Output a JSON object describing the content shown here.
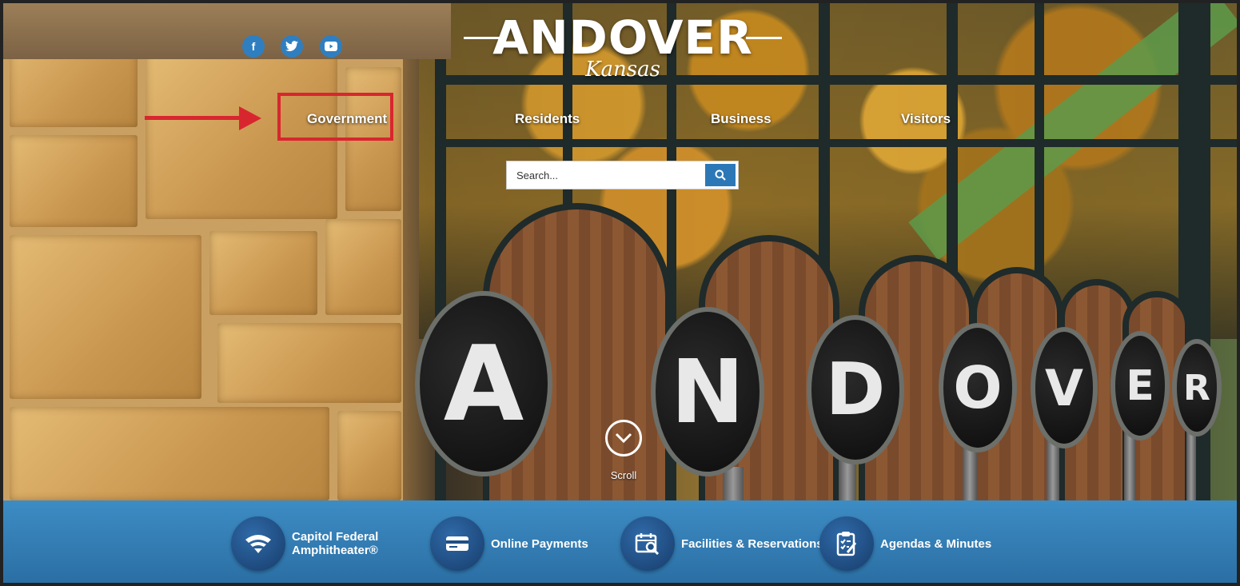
{
  "logo": {
    "title": "ANDOVER",
    "subtitle": "Kansas"
  },
  "social": {
    "facebook": "facebook-icon",
    "twitter": "twitter-icon",
    "youtube": "youtube-icon"
  },
  "nav": {
    "government": "Government",
    "residents": "Residents",
    "business": "Business",
    "visitors": "Visitors"
  },
  "search": {
    "placeholder": "Search..."
  },
  "scroll": {
    "label": "Scroll"
  },
  "sign_letters": [
    "A",
    "N",
    "D",
    "O",
    "V",
    "E",
    "R"
  ],
  "quick_links": [
    {
      "label_line1": "Capitol Federal",
      "label_line2": "Amphitheater®",
      "icon": "amphitheater-icon"
    },
    {
      "label": "Online Payments",
      "icon": "credit-card-icon"
    },
    {
      "label": "Facilities & Reservations",
      "icon": "calendar-search-icon"
    },
    {
      "label": "Agendas & Minutes",
      "icon": "clipboard-icon"
    }
  ],
  "colors": {
    "accent": "#2c78b7",
    "highlight": "#d8262f",
    "quick_bar": "#2f7dba"
  }
}
